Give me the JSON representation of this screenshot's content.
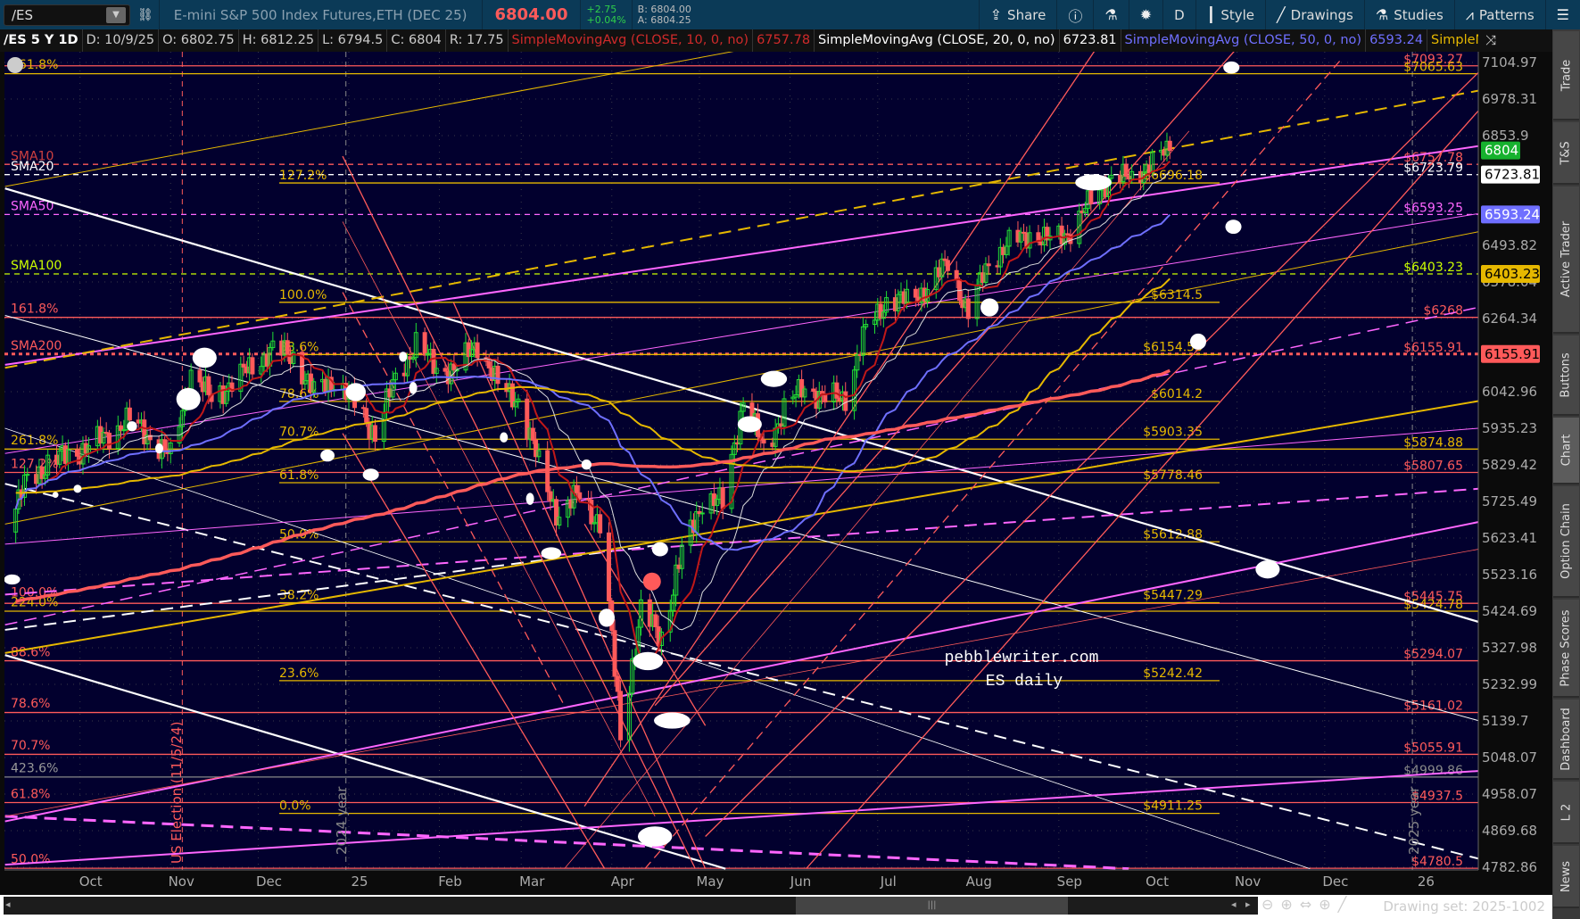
{
  "toolbar": {
    "symbol": "/ES",
    "description": "E-mini S&P 500 Index Futures,ETH (DEC 25)",
    "last": "6804.00",
    "change": "+2.75",
    "change_pct": "+0.04%",
    "bid": "B: 6804.00",
    "ask": "A: 6804.25",
    "buttons": [
      {
        "label": "Share",
        "icon": "share-icon"
      },
      {
        "label": "",
        "icon": "info-icon"
      },
      {
        "label": "",
        "icon": "flask-icon"
      },
      {
        "label": "",
        "icon": "gear-icon"
      },
      {
        "label": "D",
        "icon": ""
      },
      {
        "label": "Style",
        "icon": "candle-icon"
      },
      {
        "label": "Drawings",
        "icon": "pencil-icon"
      },
      {
        "label": "Studies",
        "icon": "flask-icon"
      },
      {
        "label": "Patterns",
        "icon": "patterns-icon"
      },
      {
        "label": "",
        "icon": "menu-icon"
      }
    ]
  },
  "legend": {
    "symbol": "/ES 5 Y 1D",
    "date": "D: 10/9/25",
    "open": "O: 6802.75",
    "high": "H: 6812.25",
    "low": "L: 6794.5",
    "close": "C: 6804",
    "range": "R: 17.75",
    "studies": [
      {
        "name": "SimpleMovingAvg (CLOSE, 10, 0, no)",
        "value": "6757.78",
        "color": "#d02a2a"
      },
      {
        "name": "SimpleMovingAvg (CLOSE, 20, 0, no)",
        "value": "6723.81",
        "color": "#ffffff"
      },
      {
        "name": "SimpleMovingAvg (CLOSE, 50, 0, no)",
        "value": "6593.24",
        "color": "#6f6fff"
      },
      {
        "name": "SimpleMoving...",
        "value": "",
        "color": "#e6b800"
      }
    ]
  },
  "sidebar": {
    "tabs": [
      "Trade",
      "T&S",
      "Active Trader",
      "Buttons",
      "Chart",
      "Option Chain",
      "Phase Scores",
      "Dashboard",
      "L 2",
      "News"
    ],
    "selected": "Chart"
  },
  "bottom": {
    "drawing_set": "Drawing set: 2025-1002"
  },
  "chart_data": {
    "type": "candlestick",
    "title": "/ES 5 Y 1D",
    "scale": "log",
    "ylim": [
      4782.86,
      7104.97
    ],
    "y_ticks": [
      "7104.97",
      "6978.31",
      "6853.9",
      "6493.82",
      "6378.04",
      "6264.34",
      "6042.96",
      "5935.23",
      "5829.42",
      "5725.49",
      "5623.41",
      "5523.16",
      "5424.69",
      "5327.98",
      "5232.99",
      "5139.7",
      "5048.07",
      "4958.07",
      "4869.68",
      "4782.86"
    ],
    "x_ticks": [
      {
        "label": "Oct",
        "date": "2024-10-01"
      },
      {
        "label": "Nov",
        "date": "2024-11-01"
      },
      {
        "label": "Dec",
        "date": "2024-12-01"
      },
      {
        "label": "25",
        "date": "2025-01-01"
      },
      {
        "label": "Feb",
        "date": "2025-02-01"
      },
      {
        "label": "Mar",
        "date": "2025-03-01"
      },
      {
        "label": "Apr",
        "date": "2025-04-01"
      },
      {
        "label": "May",
        "date": "2025-05-01"
      },
      {
        "label": "Jun",
        "date": "2025-06-01"
      },
      {
        "label": "Jul",
        "date": "2025-07-01"
      },
      {
        "label": "Aug",
        "date": "2025-08-01"
      },
      {
        "label": "Sep",
        "date": "2025-09-01"
      },
      {
        "label": "Oct",
        "date": "2025-10-01"
      },
      {
        "label": "Nov",
        "date": "2025-11-01"
      },
      {
        "label": "Dec",
        "date": "2025-12-01"
      },
      {
        "label": "26",
        "date": "2026-01-01"
      }
    ],
    "price_tags": [
      {
        "value": "6804",
        "price": 6804,
        "bg": "#16b22e",
        "fg": "#ffffff"
      },
      {
        "value": "6723.81",
        "price": 6723.81,
        "bg": "#ffffff",
        "fg": "#000000"
      },
      {
        "value": "6593.24",
        "price": 6593.24,
        "bg": "#6f6fff",
        "fg": "#ffffff"
      },
      {
        "value": "6403.23",
        "price": 6403.23,
        "bg": "#e6b800",
        "fg": "#000000"
      },
      {
        "value": "6155.91",
        "price": 6155.91,
        "bg": "#ff5a5a",
        "fg": "#000000"
      }
    ],
    "weekly_closes": [
      [
        "2024-09-06",
        5640
      ],
      [
        "2024-09-13",
        5790
      ],
      [
        "2024-09-20",
        5830
      ],
      [
        "2024-09-27",
        5860
      ],
      [
        "2024-10-04",
        5880
      ],
      [
        "2024-10-11",
        5920
      ],
      [
        "2024-10-18",
        5960
      ],
      [
        "2024-10-25",
        5910
      ],
      [
        "2024-11-01",
        5850
      ],
      [
        "2024-11-08",
        6100
      ],
      [
        "2024-11-15",
        6020
      ],
      [
        "2024-11-22",
        6070
      ],
      [
        "2024-11-29",
        6120
      ],
      [
        "2024-12-06",
        6170
      ],
      [
        "2024-12-13",
        6150
      ],
      [
        "2024-12-20",
        6040
      ],
      [
        "2024-12-27",
        6080
      ],
      [
        "2025-01-03",
        6010
      ],
      [
        "2025-01-10",
        5920
      ],
      [
        "2025-01-17",
        6080
      ],
      [
        "2025-01-24",
        6190
      ],
      [
        "2025-01-31",
        6110
      ],
      [
        "2025-02-07",
        6110
      ],
      [
        "2025-02-14",
        6190
      ],
      [
        "2025-02-21",
        6060
      ],
      [
        "2025-02-28",
        6020
      ],
      [
        "2025-03-07",
        5830
      ],
      [
        "2025-03-14",
        5680
      ],
      [
        "2025-03-21",
        5750
      ],
      [
        "2025-03-28",
        5660
      ],
      [
        "2025-04-04",
        5110
      ],
      [
        "2025-04-11",
        5420
      ],
      [
        "2025-04-18",
        5360
      ],
      [
        "2025-04-25",
        5580
      ],
      [
        "2025-05-02",
        5730
      ],
      [
        "2025-05-09",
        5720
      ],
      [
        "2025-05-16",
        6020
      ],
      [
        "2025-05-23",
        5870
      ],
      [
        "2025-05-30",
        5990
      ],
      [
        "2025-06-06",
        6060
      ],
      [
        "2025-06-13",
        6020
      ],
      [
        "2025-06-20",
        6030
      ],
      [
        "2025-06-27",
        6230
      ],
      [
        "2025-07-04",
        6320
      ],
      [
        "2025-07-11",
        6320
      ],
      [
        "2025-07-18",
        6360
      ],
      [
        "2025-07-25",
        6440
      ],
      [
        "2025-08-01",
        6280
      ],
      [
        "2025-08-08",
        6440
      ],
      [
        "2025-08-15",
        6500
      ],
      [
        "2025-08-22",
        6530
      ],
      [
        "2025-08-29",
        6510
      ],
      [
        "2025-09-05",
        6540
      ],
      [
        "2025-09-12",
        6640
      ],
      [
        "2025-09-19",
        6720
      ],
      [
        "2025-09-26",
        6710
      ],
      [
        "2025-10-03",
        6770
      ],
      [
        "2025-10-09",
        6804
      ]
    ],
    "right_levels": [
      {
        "label": "$7093.27",
        "price": 7093.27,
        "color": "#ff5a5a",
        "style": "solid"
      },
      {
        "label": "$7065.63",
        "price": 7065.63,
        "color": "#e6b800",
        "style": "solid"
      },
      {
        "label": "$6757.78",
        "price": 6757.78,
        "color": "#ff5a5a",
        "style": "dash"
      },
      {
        "label": "$6723.79",
        "price": 6723.79,
        "color": "#ffffff",
        "style": "dash"
      },
      {
        "label": "$6593.25",
        "price": 6593.25,
        "color": "#ff66ff",
        "style": "dash"
      },
      {
        "label": "$6403.23",
        "price": 6403.23,
        "color": "#ccff00",
        "style": "dash"
      },
      {
        "label": "$6268",
        "price": 6268,
        "color": "#ff5a5a",
        "style": "solid"
      },
      {
        "label": "$6155.91",
        "price": 6155.91,
        "color": "#ff5a5a",
        "style": "dot"
      },
      {
        "label": "$5874.88",
        "price": 5874.88,
        "color": "#e6b800",
        "style": "solid"
      },
      {
        "label": "$5807.65",
        "price": 5807.65,
        "color": "#ff5a5a",
        "style": "solid"
      },
      {
        "label": "$5445.75",
        "price": 5445.75,
        "color": "#ff5a5a",
        "style": "solid"
      },
      {
        "label": "$5424.78",
        "price": 5424.78,
        "color": "#e6b800",
        "style": "solid"
      },
      {
        "label": "$5294.07",
        "price": 5294.07,
        "color": "#ff5a5a",
        "style": "solid"
      },
      {
        "label": "$5161.02",
        "price": 5161.02,
        "color": "#ff5a5a",
        "style": "solid"
      },
      {
        "label": "$5055.91",
        "price": 5055.91,
        "color": "#ff5a5a",
        "style": "solid"
      },
      {
        "label": "$4999.86",
        "price": 4999.86,
        "color": "#888888",
        "style": "solid"
      },
      {
        "label": "$4937.5",
        "price": 4937.5,
        "color": "#ff5a5a",
        "style": "solid"
      },
      {
        "label": "$4780.5",
        "price": 4780.5,
        "color": "#ff5a5a",
        "style": "solid"
      }
    ],
    "fib_levels": [
      {
        "pct": "127.2%",
        "label": "$6696.18",
        "price": 6696.18
      },
      {
        "pct": "100.0%",
        "label": "$6314.5",
        "price": 6314.5
      },
      {
        "pct": "88.6%",
        "label": "$6154.53",
        "price": 6154.53
      },
      {
        "pct": "78.6%",
        "label": "$6014.2",
        "price": 6014.2
      },
      {
        "pct": "70.7%",
        "label": "$5903.35",
        "price": 5903.35
      },
      {
        "pct": "61.8%",
        "label": "$5778.46",
        "price": 5778.46
      },
      {
        "pct": "50.0%",
        "label": "$5612.88",
        "price": 5612.88
      },
      {
        "pct": "38.2%",
        "label": "$5447.29",
        "price": 5447.29
      },
      {
        "pct": "23.6%",
        "label": "$5242.42",
        "price": 5242.42
      },
      {
        "pct": "0.0%",
        "label": "$4911.25",
        "price": 4911.25
      }
    ],
    "left_labels": [
      {
        "text": "161.8%",
        "price": 7070,
        "color": "#e6b800"
      },
      {
        "text": "SMA10",
        "price": 6760,
        "color": "#d04040"
      },
      {
        "text": "SMA20",
        "price": 6726,
        "color": "#ffffff"
      },
      {
        "text": "SMA50",
        "price": 6596,
        "color": "#ff66ff"
      },
      {
        "text": "SMA100",
        "price": 6406,
        "color": "#ccff00"
      },
      {
        "text": "161.8%",
        "price": 6271,
        "color": "#ff5a5a"
      },
      {
        "text": "SMA200",
        "price": 6158,
        "color": "#ff5a5a"
      },
      {
        "text": "261.8%",
        "price": 5878,
        "color": "#e6b800"
      },
      {
        "text": "127.2%",
        "price": 5810,
        "color": "#ff5a5a"
      },
      {
        "text": "100.0%",
        "price": 5455,
        "color": "#ff5a5a"
      },
      {
        "text": "224.0%",
        "price": 5428,
        "color": "#e6b800"
      },
      {
        "text": "88.6%",
        "price": 5297,
        "color": "#ff5a5a"
      },
      {
        "text": "78.6%",
        "price": 5164,
        "color": "#ff5a5a"
      },
      {
        "text": "70.7%",
        "price": 5059,
        "color": "#ff5a5a"
      },
      {
        "text": "423.6%",
        "price": 5003,
        "color": "#999999"
      },
      {
        "text": "61.8%",
        "price": 4940,
        "color": "#ff5a5a"
      },
      {
        "text": "50.0%",
        "price": 4784,
        "color": "#ff5a5a"
      }
    ],
    "annotations": {
      "watermark1": "pebblewriter.com",
      "watermark2": "ES daily",
      "election": "US Election (11/5/24)",
      "year2024": "2024 year",
      "year2025": "2025 year"
    }
  }
}
